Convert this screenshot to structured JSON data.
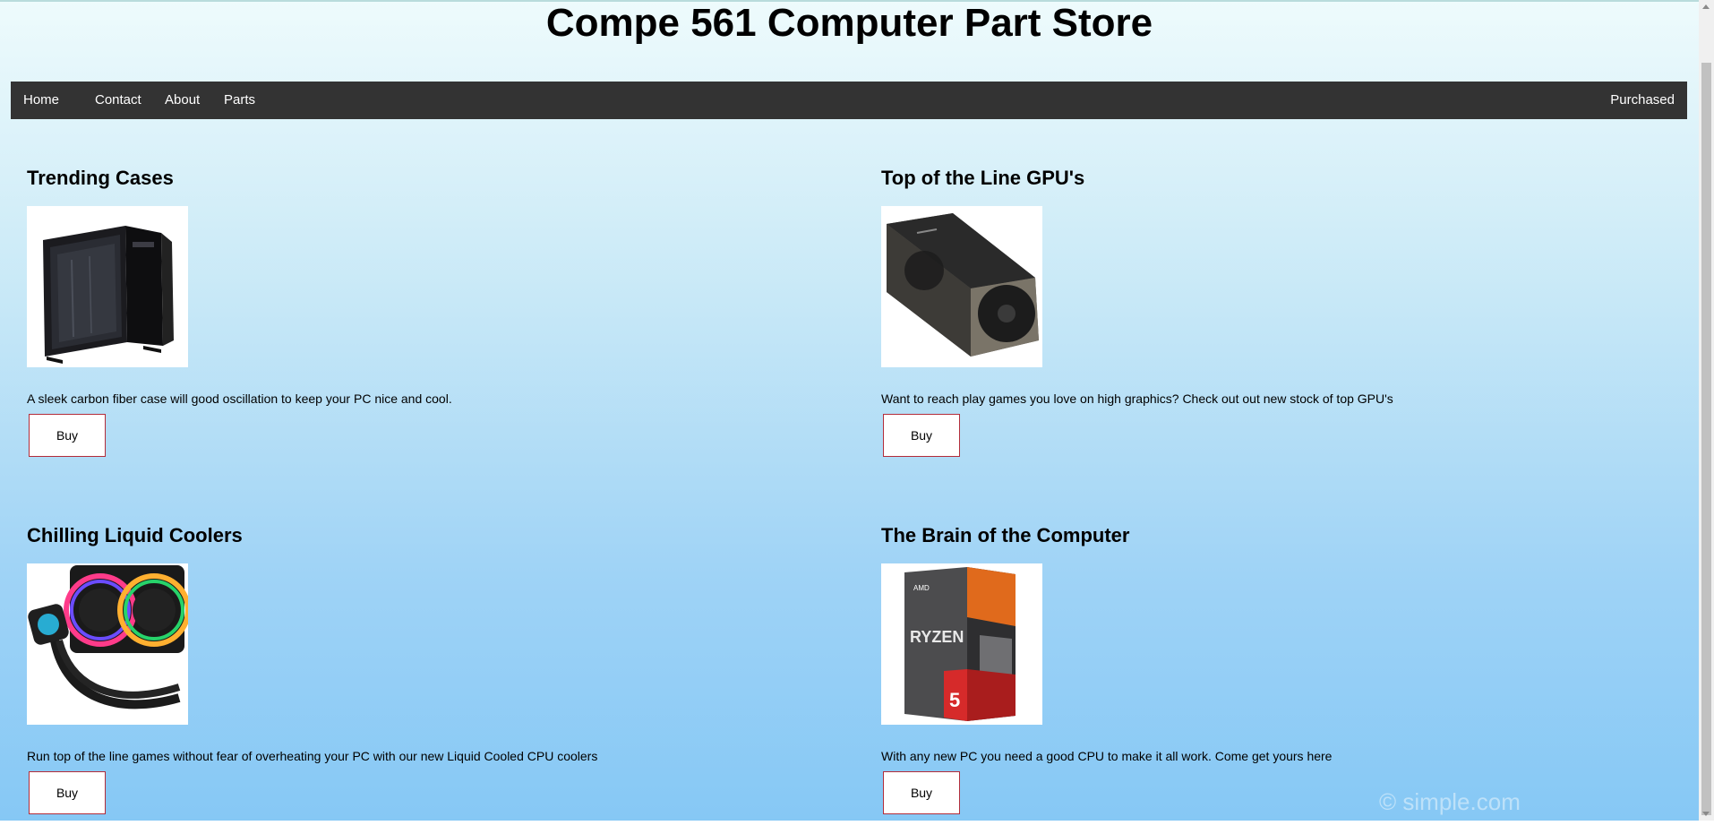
{
  "site": {
    "title": "Compe 561 Computer Part Store"
  },
  "nav": {
    "items": [
      {
        "label": "Home"
      },
      {
        "label": "Contact"
      },
      {
        "label": "About"
      },
      {
        "label": "Parts"
      }
    ],
    "right_item": {
      "label": "Purchased"
    }
  },
  "products": [
    {
      "heading": "Trending Cases",
      "image_icon": "pc-case-image",
      "description": "A sleek carbon fiber case will good oscillation to keep your PC nice and cool.",
      "buy_label": "Buy"
    },
    {
      "heading": "Top of the Line GPU's",
      "image_icon": "gpu-image",
      "description": "Want to reach play games you love on high graphics? Check out out new stock of top GPU's",
      "buy_label": "Buy"
    },
    {
      "heading": "Chilling Liquid Coolers",
      "image_icon": "liquid-cooler-image",
      "description": "Run top of the line games without fear of overheating your PC with our new Liquid Cooled CPU coolers",
      "buy_label": "Buy"
    },
    {
      "heading": "The Brain of the Computer",
      "image_icon": "cpu-box-image",
      "description": "With any new PC you need a good CPU to make it all work. Come get yours here",
      "buy_label": "Buy"
    }
  ],
  "watermark": {
    "text": "© simple.com"
  },
  "colors": {
    "nav_background": "#333333",
    "buy_border": "#b32d3a",
    "page_gradient_top": "#eefbfc",
    "page_gradient_bottom": "#86c8f5"
  }
}
